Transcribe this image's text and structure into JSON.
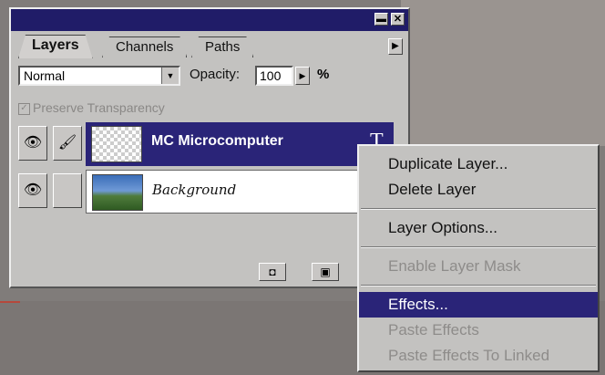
{
  "panel": {
    "tabs": [
      {
        "label": "Layers"
      },
      {
        "label": "Channels"
      },
      {
        "label": "Paths"
      }
    ],
    "blend_mode": "Normal",
    "opacity_label": "Opacity:",
    "opacity_value": "100",
    "opacity_unit": "%",
    "preserve_transparency_label": "Preserve Transparency",
    "layers": [
      {
        "name": "MC Microcomputer",
        "type_icon": "T",
        "selected": true
      },
      {
        "name": "Background",
        "selected": false
      }
    ]
  },
  "context_menu": {
    "items": [
      {
        "label": "Duplicate Layer...",
        "enabled": true
      },
      {
        "label": "Delete Layer",
        "enabled": true
      },
      {
        "label": "Layer Options...",
        "enabled": true
      },
      {
        "label": "Enable Layer Mask",
        "enabled": false
      },
      {
        "label": "Effects...",
        "enabled": true,
        "highlighted": true
      },
      {
        "label": "Paste Effects",
        "enabled": false
      },
      {
        "label": "Paste Effects To Linked",
        "enabled": false
      }
    ]
  },
  "colors": {
    "selection": "#2a2478",
    "panel": "#c3c2c0",
    "titlebar": "#201c68"
  }
}
